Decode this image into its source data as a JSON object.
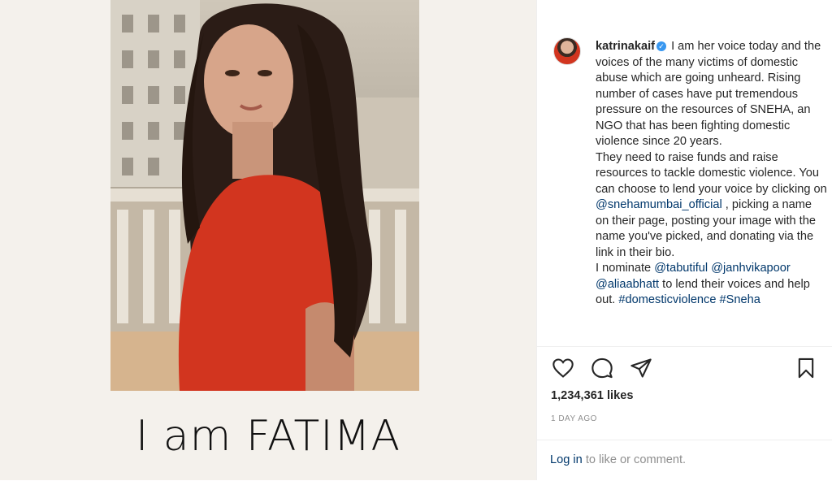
{
  "post": {
    "image_caption": "I am FATIMA",
    "username": "katrinakaif",
    "caption_segments": [
      {
        "t": "text",
        "v": " I am her voice today and the voices of the many victims of domestic abuse which are going unheard. Rising number of cases have put tremendous pressure on the resources of SNEHA, an NGO that has been fighting domestic violence since 20 years."
      },
      {
        "t": "br"
      },
      {
        "t": "text",
        "v": "They need to raise funds and raise resources to tackle domestic violence. You can choose to lend your voice by clicking on "
      },
      {
        "t": "mention",
        "v": "@snehamumbai_official"
      },
      {
        "t": "text",
        "v": " , picking a name on their page, posting your image with the name you've picked, and donating via the link in their bio."
      },
      {
        "t": "br"
      },
      {
        "t": "text",
        "v": "I nominate "
      },
      {
        "t": "mention",
        "v": "@tabutiful"
      },
      {
        "t": "text",
        "v": " "
      },
      {
        "t": "mention",
        "v": "@janhvikapoor"
      },
      {
        "t": "text",
        "v": " "
      },
      {
        "t": "mention",
        "v": "@aliaabhatt"
      },
      {
        "t": "text",
        "v": " to lend their voices and help out. "
      },
      {
        "t": "tag",
        "v": "#domesticviolence"
      },
      {
        "t": "text",
        "v": " "
      },
      {
        "t": "tag",
        "v": "#Sneha"
      }
    ],
    "likes": "1,234,361 likes",
    "time": "1 DAY AGO",
    "login_link": "Log in",
    "login_rest": " to like or comment."
  },
  "icons": {
    "like": "heart-icon",
    "comment": "comment-icon",
    "share": "paper-plane-icon",
    "save": "bookmark-icon",
    "verified": "verified-badge-icon"
  },
  "colors": {
    "link": "#00376b",
    "verified": "#3897f0",
    "shirt": "#d2351f"
  }
}
